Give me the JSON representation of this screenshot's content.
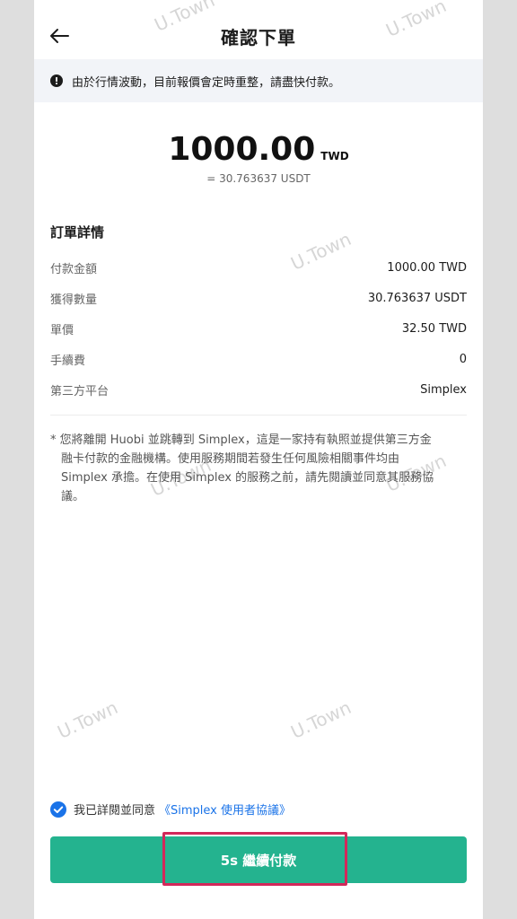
{
  "header": {
    "title": "確認下單"
  },
  "notice": {
    "text": "由於行情波動，目前報價會定時重整，請盡快付款。"
  },
  "summary": {
    "amount": "1000.00",
    "currency": "TWD",
    "usdt_equiv": "= 30.763637 USDT"
  },
  "order": {
    "title": "訂單詳情",
    "rows": [
      {
        "label": "付款金額",
        "value": "1000.00 TWD"
      },
      {
        "label": "獲得數量",
        "value": "30.763637 USDT"
      },
      {
        "label": "單價",
        "value": "32.50 TWD"
      },
      {
        "label": "手續費",
        "value": "0"
      },
      {
        "label": "第三方平台",
        "value": "Simplex"
      }
    ]
  },
  "disclaimer": {
    "lines": [
      "* 您將離開 Huobi 並跳轉到 Simplex，這是一家持有執照並提供第三方金",
      "融卡付款的金融機構。使用服務期間若發生任何風險相關事件均由",
      "Simplex 承擔。在使用 Simplex 的服務之前，請先閱讀並同意其服務協",
      "議。"
    ]
  },
  "agreement": {
    "text": "我已詳閱並同意",
    "link": "《Simplex 使用者協議》",
    "checked": true
  },
  "pay_button": {
    "label": "5s 繼續付款"
  },
  "watermark": {
    "text": "U.Town"
  },
  "colors": {
    "accent": "#24b38f",
    "link": "#1a73e8",
    "highlight": "#d2285a",
    "notice_bg": "#f2f4f8"
  }
}
